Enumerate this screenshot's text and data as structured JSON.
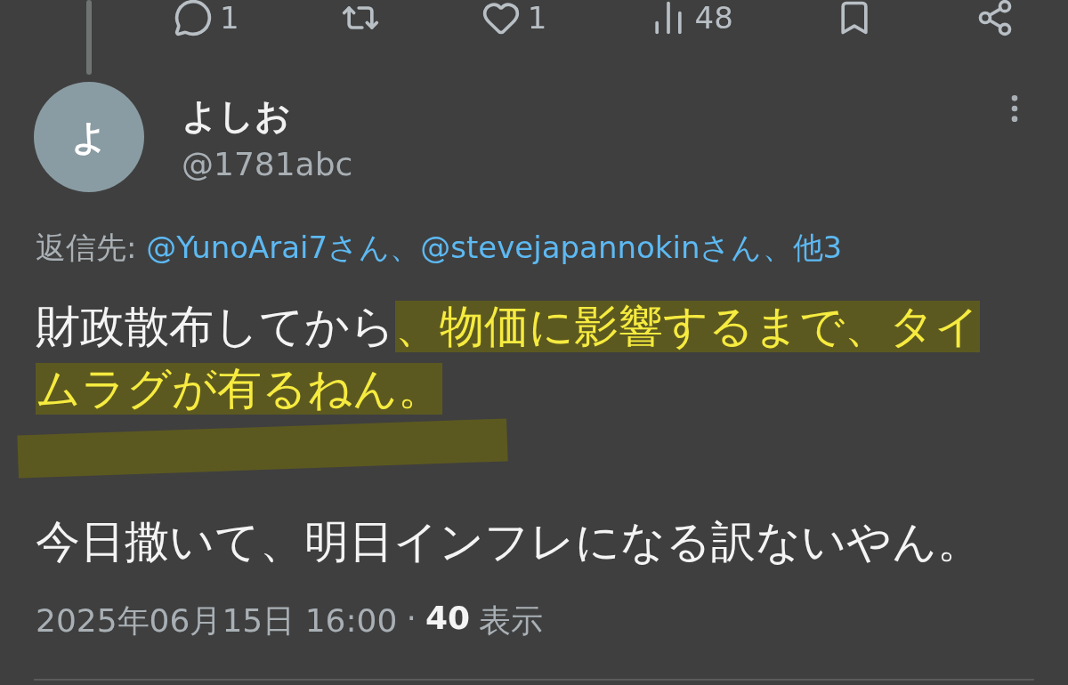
{
  "actions": [
    {
      "kind": "reply",
      "count": "1"
    },
    {
      "kind": "repost"
    },
    {
      "kind": "like",
      "count": "1"
    },
    {
      "kind": "views",
      "count": "48"
    },
    {
      "kind": "bookmark"
    },
    {
      "kind": "share"
    }
  ],
  "author": {
    "avatar_letter": "よ",
    "name": "よしお",
    "handle": "@1781abc"
  },
  "reply_to": {
    "label": "返信先:",
    "mentions": [
      "@YunoArai7さん",
      "@stevejapannokinさん"
    ],
    "separator": "、",
    "others": "他3"
  },
  "body": [
    {
      "segments": [
        {
          "text": "財政散布してから",
          "highlighted": false
        },
        {
          "text": "、物価に影響するまで、タイムラグが有るねん。",
          "highlighted": true
        }
      ],
      "trailing_mark": true
    },
    {
      "segments": [
        {
          "text": "今日撒いて、明日インフレになる訳ないやん。",
          "highlighted": false
        }
      ],
      "trailing_mark": false
    }
  ],
  "meta": {
    "timestamp": "2025年06月15日 16:00",
    "dot": "·",
    "views": "40",
    "views_label": "表示"
  }
}
